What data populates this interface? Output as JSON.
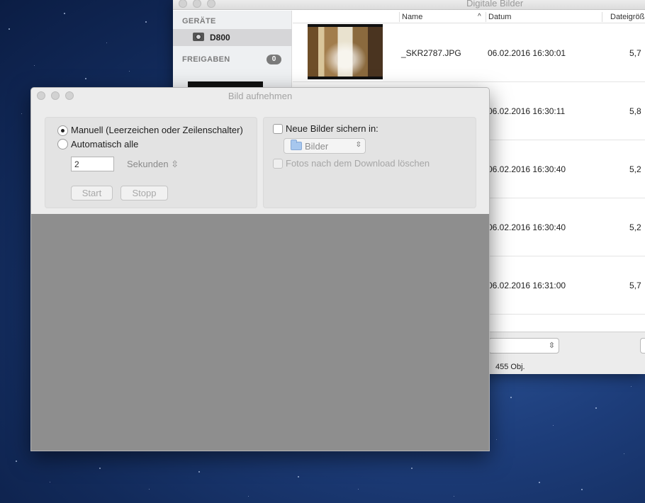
{
  "background_window": {
    "title": "Digitale Bilder",
    "sidebar": {
      "devices_header": "GERÄTE",
      "device_name": "D800",
      "shares_header": "FREIGABEN",
      "shares_count": "0"
    },
    "columns": {
      "name": "Name",
      "sort_indicator": "^",
      "date": "Datum",
      "size": "Dateigröß"
    },
    "rows": [
      {
        "name": "_SKR2787.JPG",
        "date": "06.02.2016 16:30:01",
        "size": "5,7"
      },
      {
        "name": "",
        "date": "06.02.2016 16:30:11",
        "size": "5,8"
      },
      {
        "name": "",
        "date": "06.02.2016 16:30:40",
        "size": "5,2"
      },
      {
        "name": "",
        "date": "06.02.2016 16:30:40",
        "size": "5,2"
      },
      {
        "name": "",
        "date": "06.02.2016 16:31:00",
        "size": "5,7"
      }
    ],
    "object_count": "455 Obj."
  },
  "dialog": {
    "title": "Bild aufnehmen",
    "left_panel": {
      "manual_label": "Manuell (Leerzeichen oder Zeilenschalter)",
      "auto_label": "Automatisch alle",
      "interval_value": "2",
      "interval_unit": "Sekunden",
      "start_label": "Start",
      "stop_label": "Stopp"
    },
    "right_panel": {
      "save_label": "Neue Bilder sichern in:",
      "folder_name": "Bilder",
      "delete_label": "Fotos nach dem Download löschen"
    }
  },
  "icons": {
    "camera": "camera-icon",
    "folder": "folder-icon",
    "chevron": "chevron-updown-icon"
  }
}
